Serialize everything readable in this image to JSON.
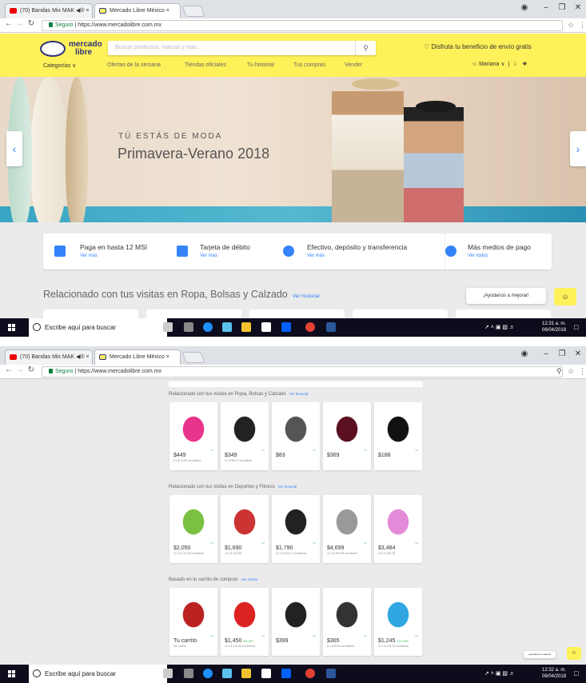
{
  "browser": {
    "tabs": [
      {
        "label": "(70) Bandas Mix MAK ◀® ×"
      },
      {
        "label": "Mercado Libre México ×"
      }
    ],
    "address_secure": "Seguro",
    "address_url": "https://www.mercadolibre.com.mx"
  },
  "header": {
    "logo_line1": "mercado",
    "logo_line2": "libre",
    "search_placeholder": "Buscar productos, marcas y más...",
    "envio": "Disfruta tu beneficio de envío gratis",
    "menu": [
      "Categorías ∨",
      "Ofertas de la semana",
      "Tiendas oficiales",
      "Tu historial",
      "Tus compras",
      "Vender"
    ],
    "user": "Mariana ∨"
  },
  "hero": {
    "eyebrow": "TÚ ESTÁS DE MODA",
    "title": "Primavera-Verano 2018"
  },
  "payments": [
    {
      "title": "Paga en hasta 12 MSI",
      "link": "Ver más"
    },
    {
      "title": "Tarjeta de débito",
      "link": "Ver más"
    },
    {
      "title": "Efectivo, depósito y transferencia",
      "link": "Ver más"
    },
    {
      "title": "Más medios de pago",
      "link": "Ver todos"
    }
  ],
  "related": {
    "title": "Relacionado con tus visitas en Ropa, Bolsas y Calzado",
    "link": "Ver historial"
  },
  "feedback": "¡Ayúdanos a mejorar!",
  "taskbar": {
    "search": "Escribe aquí para buscar",
    "time1": "12:31 a. m.",
    "time2": "12:32 a. m.",
    "date": "06/04/2018"
  },
  "sections": [
    {
      "title": "Relacionado con tus visitas en Ropa, Bolsas y Calzado",
      "link": "Ver historial",
      "items": [
        {
          "price": "$449",
          "msi": "6 x $ 74.83 sin interés",
          "color": "#e8348a"
        },
        {
          "price": "$349",
          "msi": "6 x $ 58.17 sin interés",
          "color": "#222"
        },
        {
          "price": "$83",
          "msi": "",
          "color": "#555"
        },
        {
          "price": "$369",
          "msi": "",
          "color": "#5a1020"
        },
        {
          "price": "$188",
          "msi": "",
          "color": "#111"
        }
      ]
    },
    {
      "title": "Relacionado con tus visitas en Deportes y Fitness",
      "link": "Ver historial",
      "items": [
        {
          "price": "$2,050",
          "msi": "12 x $ 170.83 sin interés",
          "color": "#7ac142"
        },
        {
          "price": "$1,690",
          "msi": "12 x $ 140.83",
          "color": "#c33"
        },
        {
          "price": "$1,790",
          "msi": "12 x $ 149.17 sin interés",
          "color": "#222"
        },
        {
          "price": "$4,699",
          "msi": "12 x $ 391.58 sin interés",
          "color": "#999"
        },
        {
          "price": "$3,484",
          "msi": "12 x $ 290.33",
          "color": "#e58ad8"
        }
      ]
    },
    {
      "title": "Basado en tu carrito de compras",
      "link": "Ver carrito",
      "items": [
        {
          "price": "Tu carrito",
          "msi": "Ver carrito",
          "color": "#b22"
        },
        {
          "price": "$1,450",
          "off": "9% OFF",
          "msi": "12 x $ 120.83 sin interés",
          "color": "#d22"
        },
        {
          "price": "$399",
          "msi": "",
          "color": "#222"
        },
        {
          "price": "$365",
          "msi": "6 x $ 60.83 sin interés",
          "color": "#333"
        },
        {
          "price": "$1,245",
          "off": "17% OFF",
          "msi": "12 x $ 103.75 sin interés",
          "color": "#2fa6e0"
        }
      ]
    }
  ]
}
